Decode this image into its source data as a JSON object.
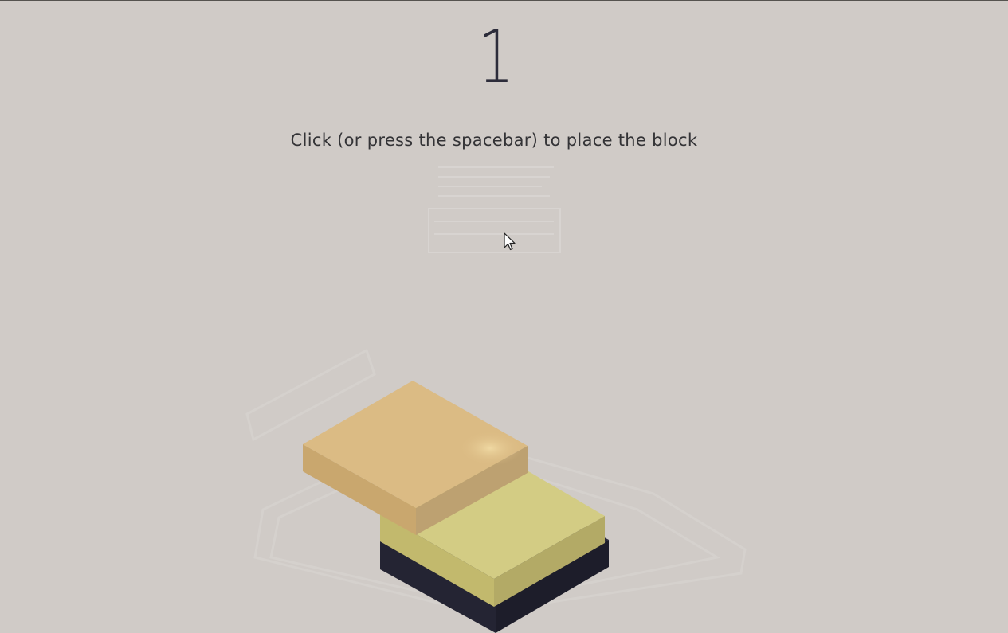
{
  "game": {
    "score": "1",
    "instructions": "Click (or press the spacebar) to place the block"
  },
  "colors": {
    "background": "#d0cbc7",
    "base_block": "#26263a",
    "placed_block_top": "#d3cc84",
    "moving_block_top": "#dbbb84",
    "text": "#2c2c3a"
  },
  "icons": {
    "cursor": "mouse-pointer-icon"
  }
}
